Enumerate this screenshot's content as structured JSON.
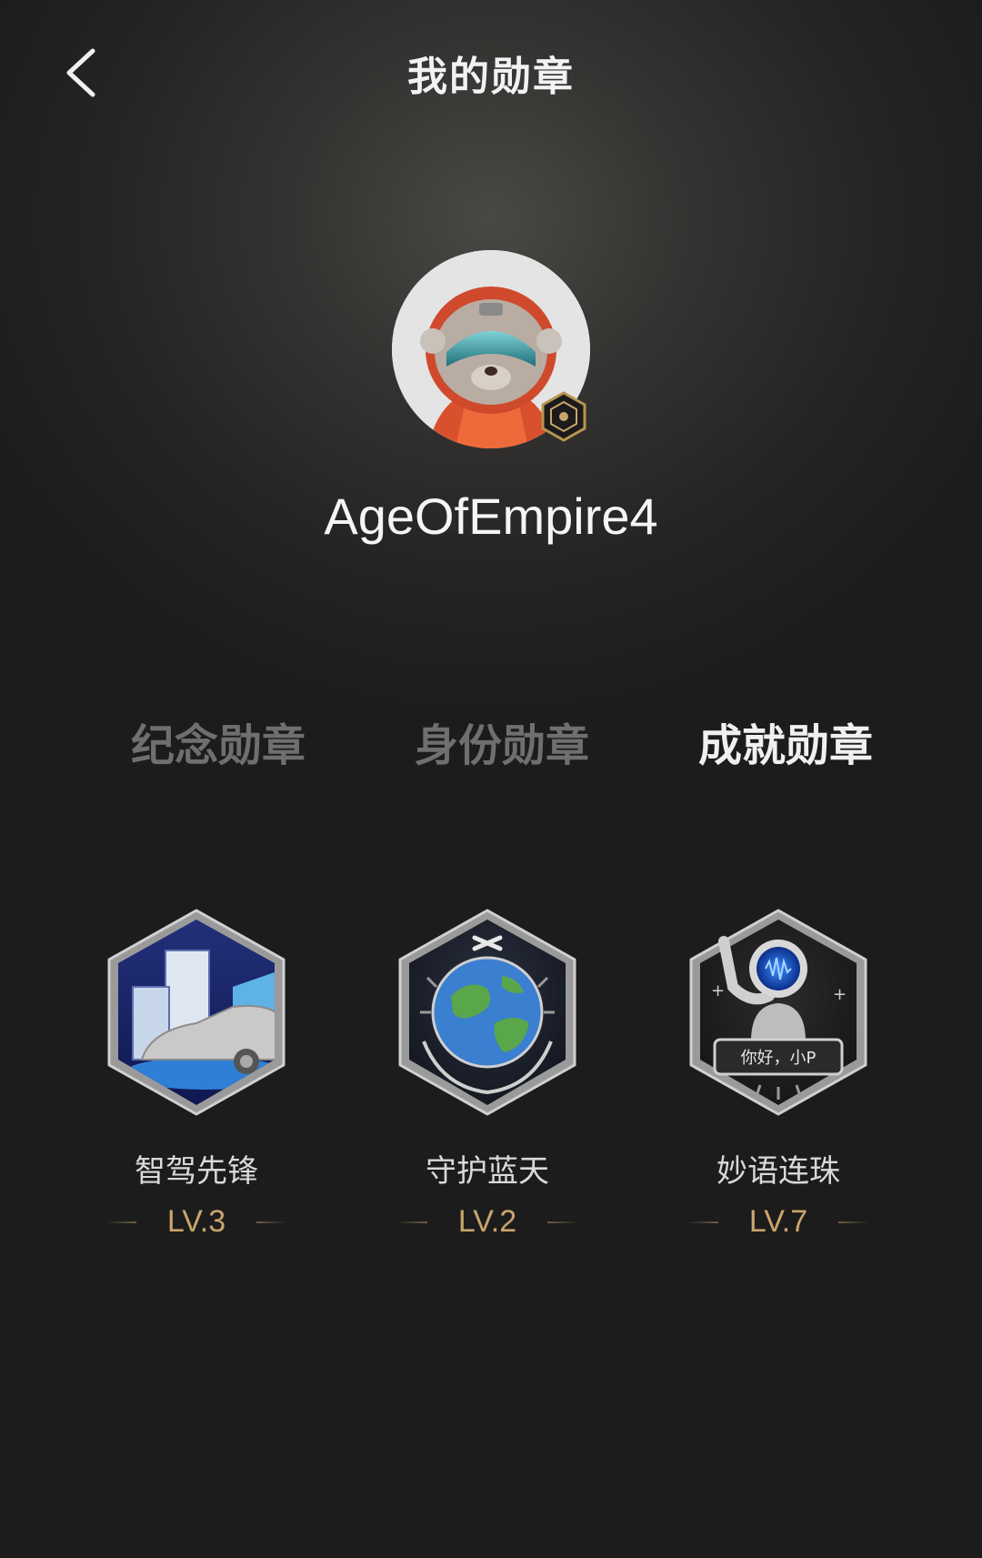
{
  "header": {
    "title": "我的勋章",
    "back_icon": "chevron-left-icon"
  },
  "profile": {
    "username": "AgeOfEmpire4",
    "avatar": "astronaut-otter-avatar",
    "avatar_badge": "gold-hexagon-badge-icon"
  },
  "tabs": [
    {
      "label": "纪念勋章",
      "active": false
    },
    {
      "label": "身份勋章",
      "active": false
    },
    {
      "label": "成就勋章",
      "active": true
    }
  ],
  "medals": [
    {
      "name": "智驾先锋",
      "level": "LV.3",
      "icon": "car-city-medal-icon"
    },
    {
      "name": "守护蓝天",
      "level": "LV.2",
      "icon": "earth-hands-medal-icon"
    },
    {
      "name": "妙语连珠",
      "level": "LV.7",
      "icon": "robot-voice-medal-icon",
      "speech_text": "你好，小P"
    }
  ],
  "colors": {
    "background": "#1c1c1c",
    "title": "#f2f2f2",
    "tab_active": "#f0f0f0",
    "tab_inactive": "#6f6f6f",
    "level_gold": "#c9a56c"
  }
}
